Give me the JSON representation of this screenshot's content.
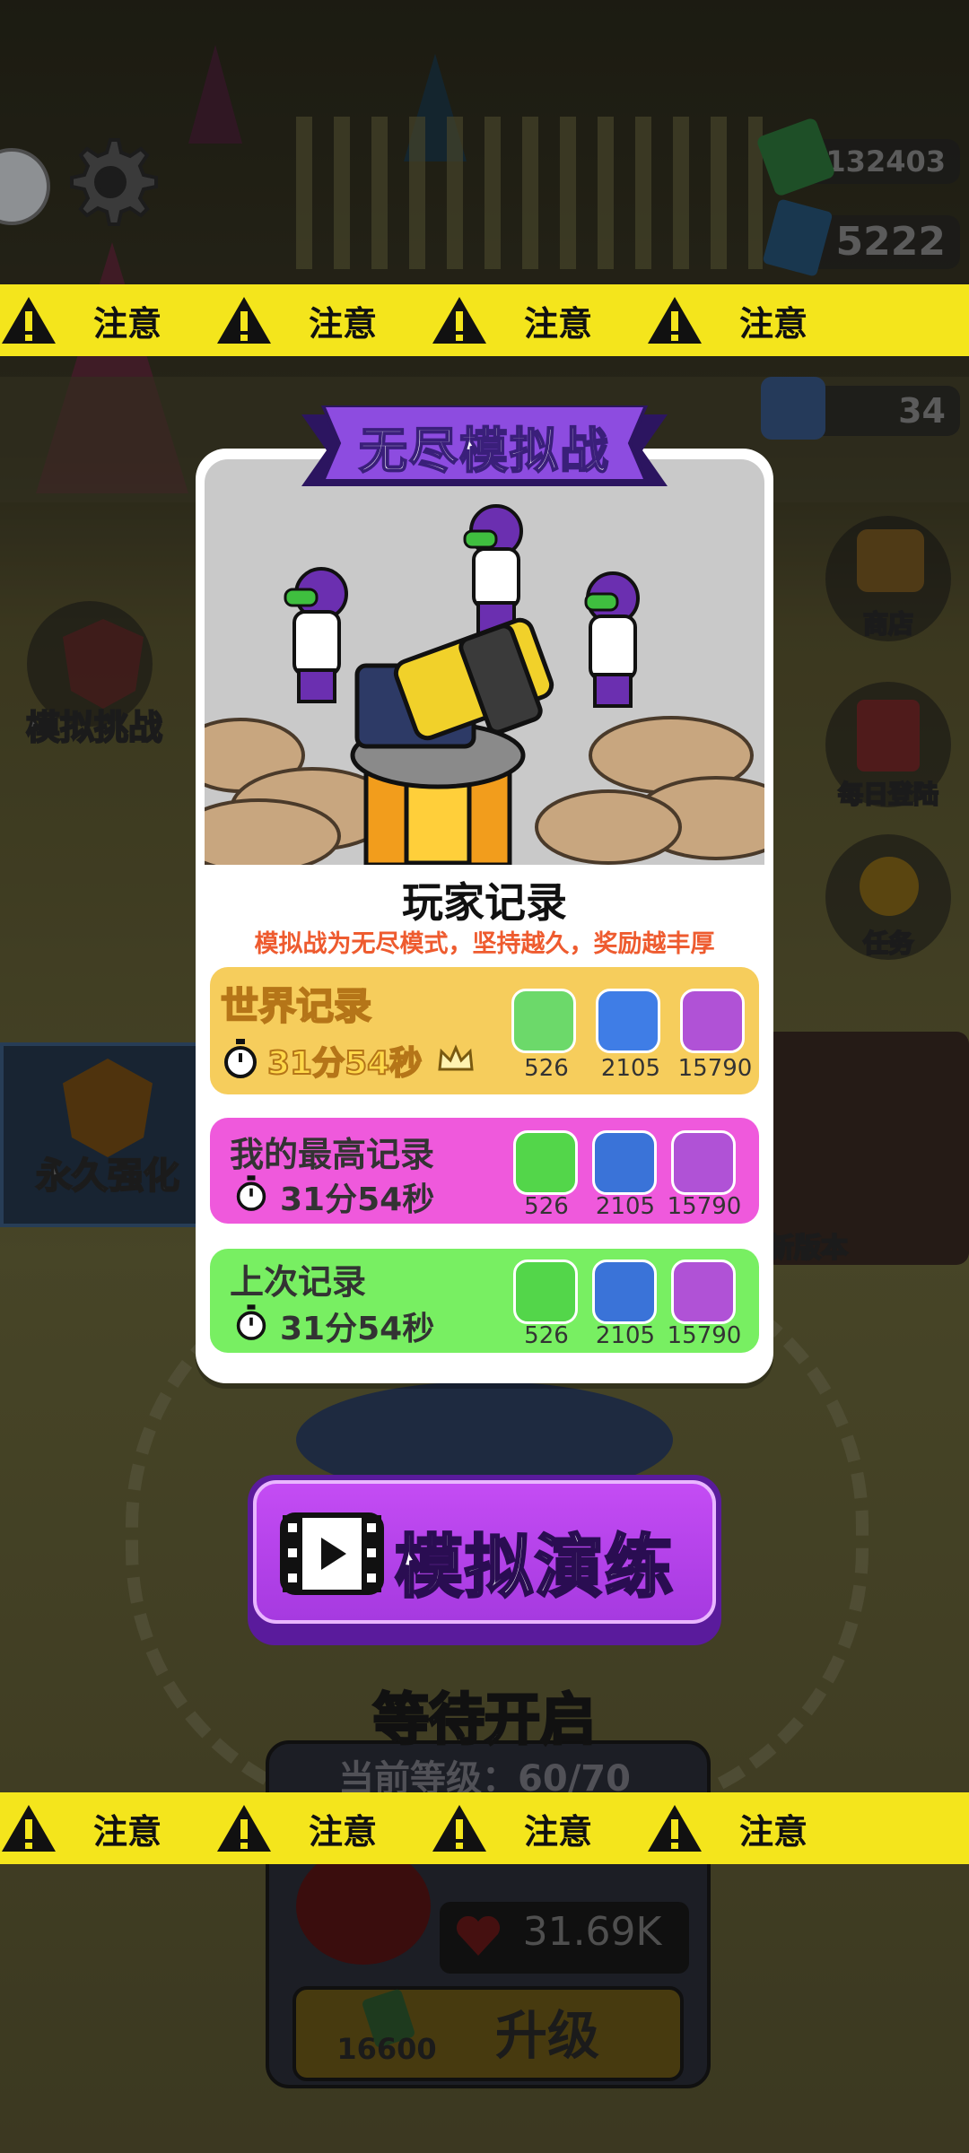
{
  "hud": {
    "currency1": "132403",
    "currency2": "5222",
    "tickets": "34"
  },
  "side_menu": {
    "left": [
      {
        "label": "模拟挑战"
      },
      {
        "label": "永久强化"
      }
    ],
    "right": [
      {
        "label": "商店"
      },
      {
        "label": "每日登陆"
      },
      {
        "label": "任务"
      },
      {
        "label": "新版本"
      }
    ]
  },
  "tape": {
    "text": "注意",
    "color": "#f4e51c"
  },
  "modal": {
    "title": "无尽模拟战",
    "section_title": "玩家记录",
    "subtitle": "模拟战为无尽模式，坚持越久，奖励越丰厚",
    "records": [
      {
        "title": "世界记录",
        "time": "31分54秒",
        "rewards": [
          "526",
          "2105",
          "15790"
        ],
        "color": "#f6cd5c"
      },
      {
        "title": "我的最高记录",
        "time": "31分54秒",
        "rewards": [
          "526",
          "2105",
          "15790"
        ],
        "color": "#ef59dc"
      },
      {
        "title": "上次记录",
        "time": "31分54秒",
        "rewards": [
          "526",
          "2105",
          "15790"
        ],
        "color": "#78ef62"
      }
    ]
  },
  "actions": {
    "simulate_label": "模拟演练",
    "waiting_label": "等待开启"
  },
  "bottom_panel": {
    "level": "当前等级：60/70",
    "hp": "31.69K",
    "upgrade_cost": "16600",
    "upgrade_label": "升级"
  }
}
